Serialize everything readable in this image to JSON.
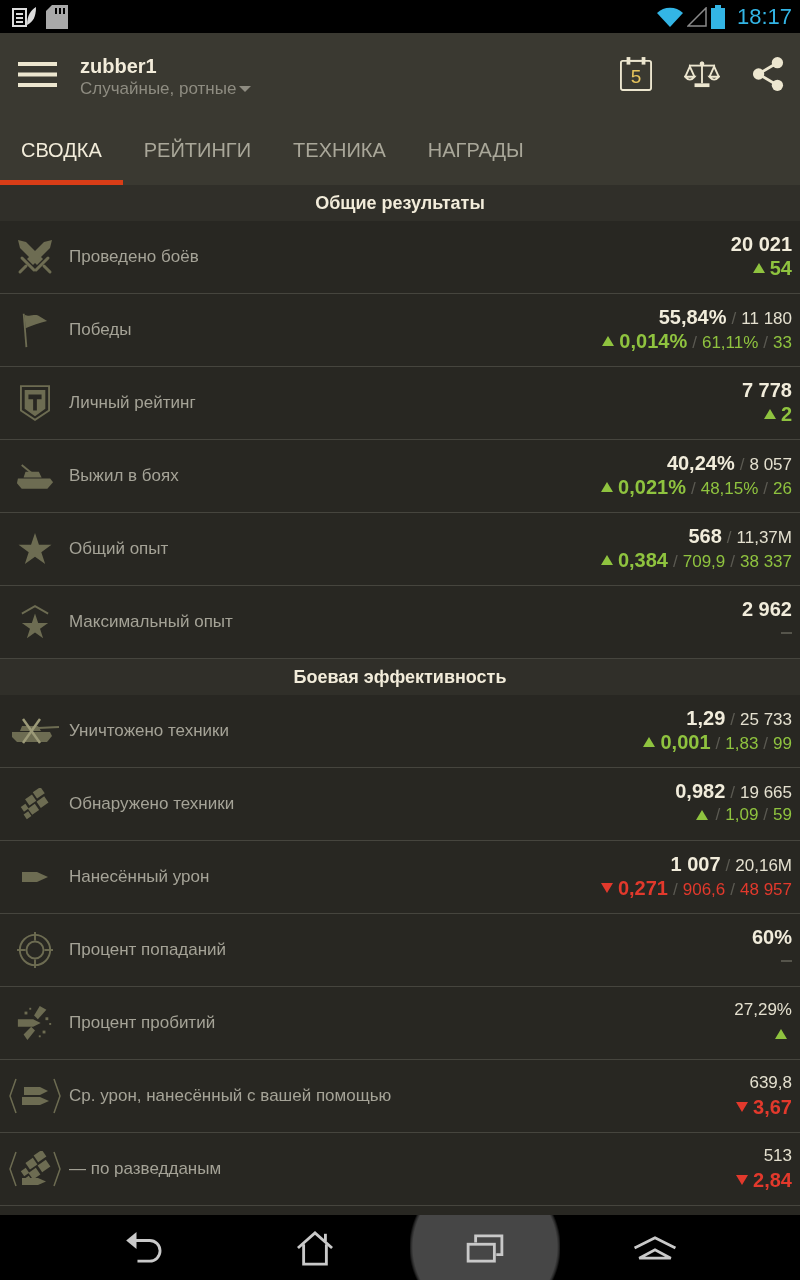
{
  "status_bar": {
    "time": "18:17"
  },
  "header": {
    "title": "zubber1",
    "subtitle": "Случайные, ротные",
    "calendar_day": "5"
  },
  "tabs": [
    {
      "label": "СВОДКА",
      "selected": true
    },
    {
      "label": "РЕЙТИНГИ",
      "selected": false
    },
    {
      "label": "ТЕХНИКА",
      "selected": false
    },
    {
      "label": "НАГРАДЫ",
      "selected": false
    }
  ],
  "sections": [
    {
      "title": "Общие результаты",
      "rows": [
        {
          "label": "Проведено боёв",
          "kind": "up",
          "main": [
            {
              "kind": "value",
              "text": "20 021"
            }
          ],
          "change": [
            {
              "kind": "value",
              "text": "54"
            }
          ]
        },
        {
          "label": "Победы",
          "kind": "up",
          "main": [
            {
              "kind": "value",
              "text": "55,84%"
            },
            {
              "kind": "separator",
              "text": "/"
            },
            {
              "kind": "number",
              "text": "11 180"
            }
          ],
          "change": [
            {
              "kind": "value",
              "text": "0,014%"
            },
            {
              "kind": "separator",
              "text": "/"
            },
            {
              "kind": "number",
              "text": "61,11%"
            },
            {
              "kind": "separator",
              "text": "/"
            },
            {
              "kind": "number",
              "text": "33"
            }
          ]
        },
        {
          "label": "Личный рейтинг",
          "kind": "up",
          "main": [
            {
              "kind": "value",
              "text": "7 778"
            }
          ],
          "change": [
            {
              "kind": "value",
              "text": "2"
            }
          ]
        },
        {
          "label": "Выжил в боях",
          "kind": "up",
          "main": [
            {
              "kind": "value",
              "text": "40,24%"
            },
            {
              "kind": "separator",
              "text": "/"
            },
            {
              "kind": "number",
              "text": "8 057"
            }
          ],
          "change": [
            {
              "kind": "value",
              "text": "0,021%"
            },
            {
              "kind": "separator",
              "text": "/"
            },
            {
              "kind": "number",
              "text": "48,15%"
            },
            {
              "kind": "separator",
              "text": "/"
            },
            {
              "kind": "number",
              "text": "26"
            }
          ]
        },
        {
          "label": "Общий опыт",
          "kind": "up",
          "main": [
            {
              "kind": "value",
              "text": "568"
            },
            {
              "kind": "separator",
              "text": "/"
            },
            {
              "kind": "number",
              "text": "11,37M"
            }
          ],
          "change": [
            {
              "kind": "value",
              "text": "0,384"
            },
            {
              "kind": "separator",
              "text": "/"
            },
            {
              "kind": "number",
              "text": "709,9"
            },
            {
              "kind": "separator",
              "text": "/"
            },
            {
              "kind": "number",
              "text": "38 337"
            }
          ]
        },
        {
          "label": "Максимальный опыт",
          "kind": "flat",
          "main": [
            {
              "kind": "value",
              "text": "2 962"
            }
          ]
        }
      ]
    },
    {
      "title": "Боевая эффективность",
      "rows": [
        {
          "label": "Уничтожено техники",
          "kind": "up",
          "main": [
            {
              "kind": "value",
              "text": "1,29"
            },
            {
              "kind": "separator",
              "text": "/"
            },
            {
              "kind": "number",
              "text": "25 733"
            }
          ],
          "change": [
            {
              "kind": "value",
              "text": "0,001"
            },
            {
              "kind": "separator",
              "text": "/"
            },
            {
              "kind": "number",
              "text": "1,83"
            },
            {
              "kind": "separator",
              "text": "/"
            },
            {
              "kind": "number",
              "text": "99"
            }
          ]
        },
        {
          "label": "Обнаружено техники",
          "kind": "up",
          "main": [
            {
              "kind": "value",
              "text": "0,982"
            },
            {
              "kind": "separator",
              "text": "/"
            },
            {
              "kind": "number",
              "text": "19 665"
            }
          ],
          "change": [
            {
              "kind": "separator",
              "text": "/"
            },
            {
              "kind": "number",
              "text": "1,09"
            },
            {
              "kind": "separator",
              "text": "/"
            },
            {
              "kind": "number",
              "text": "59"
            }
          ]
        },
        {
          "label": "Нанесённый урон",
          "kind": "down",
          "main": [
            {
              "kind": "value",
              "text": "1 007"
            },
            {
              "kind": "separator",
              "text": "/"
            },
            {
              "kind": "number",
              "text": "20,16M"
            }
          ],
          "change": [
            {
              "kind": "value",
              "text": "0,271"
            },
            {
              "kind": "separator",
              "text": "/"
            },
            {
              "kind": "number",
              "text": "906,6"
            },
            {
              "kind": "separator",
              "text": "/"
            },
            {
              "kind": "number",
              "text": "48 957"
            }
          ]
        },
        {
          "label": "Процент попаданий",
          "kind": "flat",
          "main": [
            {
              "kind": "value",
              "text": "60%"
            }
          ]
        },
        {
          "label": "Процент пробитий",
          "kind": "up",
          "main": [
            {
              "kind": "number",
              "text": "27,29%"
            }
          ]
        },
        {
          "label": "Ср. урон, нанесённый с вашей помощью",
          "kind": "down",
          "main": [
            {
              "kind": "number",
              "text": "639,8"
            }
          ],
          "change": [
            {
              "kind": "value",
              "text": "3,67"
            }
          ]
        },
        {
          "label": "— по разведданым",
          "kind": "down",
          "main": [
            {
              "kind": "number",
              "text": "513"
            }
          ],
          "change": [
            {
              "kind": "value",
              "text": "2,84"
            }
          ]
        }
      ]
    }
  ],
  "nav_bar": {
    "buttons": [
      {
        "selected": false
      },
      {
        "selected": false
      },
      {
        "selected": true
      },
      {
        "selected": false
      }
    ]
  }
}
